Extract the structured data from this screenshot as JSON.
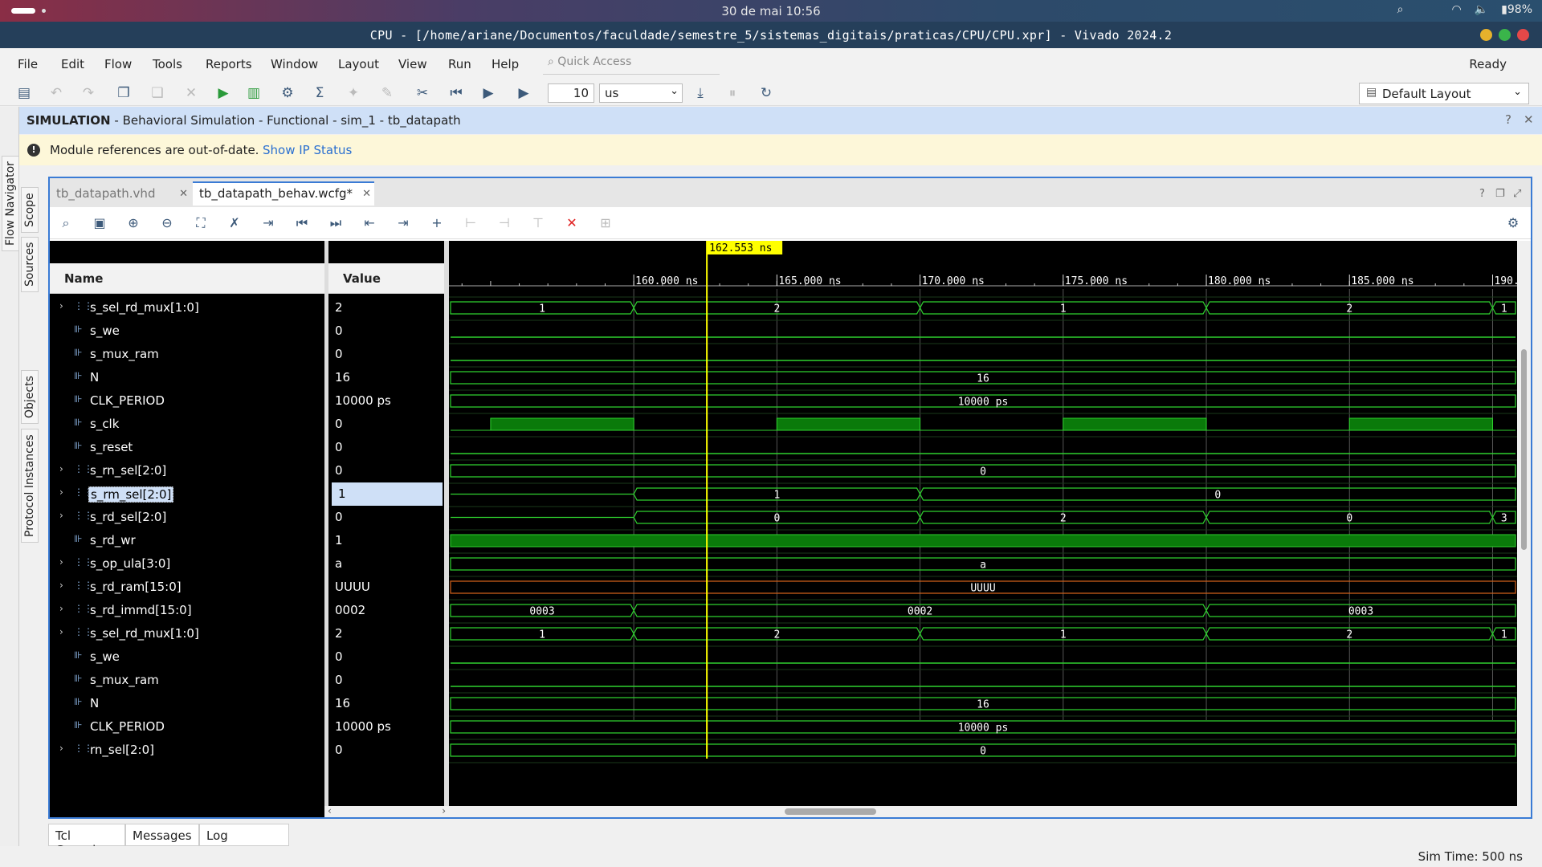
{
  "system": {
    "clock": "30 de mai 10:56",
    "battery": "98%"
  },
  "window": {
    "title": "CPU - [/home/ariane/Documentos/faculdade/semestre_5/sistemas_digitais/praticas/CPU/CPU.xpr] - Vivado 2024.2"
  },
  "menu": {
    "items": [
      "File",
      "Edit",
      "Flow",
      "Tools",
      "Reports",
      "Window",
      "Layout",
      "View",
      "Run",
      "Help"
    ],
    "quick_access_placeholder": "Quick Access",
    "status": "Ready"
  },
  "toolbar": {
    "run_time_value": "10",
    "run_time_unit": "us",
    "layout": "Default Layout"
  },
  "side_tabs": [
    "Flow Navigator",
    "Scope",
    "Sources",
    "Objects",
    "Protocol Instances"
  ],
  "sim_header": {
    "label": "SIMULATION",
    "detail": " - Behavioral Simulation - Functional - sim_1 - tb_datapath"
  },
  "notice": {
    "text": "Module references are out-of-date.",
    "link": "Show IP Status"
  },
  "editor_tabs": [
    "tb_datapath.vhd",
    "tb_datapath_behav.wcfg*"
  ],
  "columns": {
    "name": "Name",
    "value": "Value"
  },
  "signals": [
    {
      "name": "s_sel_rd_mux[1:0]",
      "value": "2",
      "bus": true
    },
    {
      "name": "s_we",
      "value": "0",
      "bus": false
    },
    {
      "name": "s_mux_ram",
      "value": "0",
      "bus": false
    },
    {
      "name": "N",
      "value": "16",
      "bus": false
    },
    {
      "name": "CLK_PERIOD",
      "value": "10000 ps",
      "bus": false
    },
    {
      "name": "s_clk",
      "value": "0",
      "bus": false
    },
    {
      "name": "s_reset",
      "value": "0",
      "bus": false
    },
    {
      "name": "s_rn_sel[2:0]",
      "value": "0",
      "bus": true
    },
    {
      "name": "s_rm_sel[2:0]",
      "value": "1",
      "bus": true,
      "selected": true
    },
    {
      "name": "s_rd_sel[2:0]",
      "value": "0",
      "bus": true
    },
    {
      "name": "s_rd_wr",
      "value": "1",
      "bus": false
    },
    {
      "name": "s_op_ula[3:0]",
      "value": "a",
      "bus": true
    },
    {
      "name": "s_rd_ram[15:0]",
      "value": "UUUU",
      "bus": true
    },
    {
      "name": "s_rd_immd[15:0]",
      "value": "0002",
      "bus": true
    },
    {
      "name": "s_sel_rd_mux[1:0]",
      "value": "2",
      "bus": true
    },
    {
      "name": "s_we",
      "value": "0",
      "bus": false
    },
    {
      "name": "s_mux_ram",
      "value": "0",
      "bus": false
    },
    {
      "name": "N",
      "value": "16",
      "bus": false
    },
    {
      "name": "CLK_PERIOD",
      "value": "10000 ps",
      "bus": false
    },
    {
      "name": "rn_sel[2:0]",
      "value": "0",
      "bus": true
    }
  ],
  "wave": {
    "cursor": "162.553 ns",
    "cursor_time_ns": 162.553,
    "time_start_ns": 153.6,
    "time_end_ns": 190.8,
    "tick_labels": [
      "160.000 ns",
      "165.000 ns",
      "170.000 ns",
      "175.000 ns",
      "180.000 ns",
      "185.000 ns",
      "190.000 ns"
    ],
    "ticks_ns": [
      160,
      165,
      170,
      175,
      180,
      185,
      190
    ],
    "clock": {
      "period_ns": 10,
      "high_start_ns": 165,
      "high_ns": 5
    },
    "buses": {
      "0": [
        {
          "t": 153.6,
          "v": "1"
        },
        {
          "t": 160,
          "v": "2"
        },
        {
          "t": 170,
          "v": "1"
        },
        {
          "t": 180,
          "v": "2"
        },
        {
          "t": 190,
          "v": "1"
        }
      ],
      "3": [
        {
          "t": 153.6,
          "v": "16"
        }
      ],
      "4": [
        {
          "t": 153.6,
          "v": "10000 ps"
        }
      ],
      "7": [
        {
          "t": 153.6,
          "v": "0"
        }
      ],
      "8": [
        {
          "t": 160,
          "v": "1"
        },
        {
          "t": 170,
          "v": "0"
        }
      ],
      "9": [
        {
          "t": 160,
          "v": "0"
        },
        {
          "t": 170,
          "v": "2"
        },
        {
          "t": 180,
          "v": "0"
        },
        {
          "t": 190,
          "v": "3"
        }
      ],
      "11": [
        {
          "t": 153.6,
          "v": "a"
        }
      ],
      "12": [
        {
          "t": 153.6,
          "v": "UUUU"
        }
      ],
      "13": [
        {
          "t": 153.6,
          "v": "0003"
        },
        {
          "t": 160,
          "v": "0002"
        },
        {
          "t": 180,
          "v": "0003"
        }
      ],
      "14": [
        {
          "t": 153.6,
          "v": "1"
        },
        {
          "t": 160,
          "v": "2"
        },
        {
          "t": 170,
          "v": "1"
        },
        {
          "t": 180,
          "v": "2"
        },
        {
          "t": 190,
          "v": "1"
        }
      ],
      "17": [
        {
          "t": 153.6,
          "v": "16"
        }
      ],
      "18": [
        {
          "t": 153.6,
          "v": "10000 ps"
        }
      ],
      "19": [
        {
          "t": 153.6,
          "v": "0"
        }
      ]
    },
    "low_rows": [
      1,
      2,
      6,
      15,
      16
    ],
    "high_rows": [
      10
    ],
    "undefined_rows": [
      12
    ],
    "clock_rows": [
      5
    ]
  },
  "bottom_tabs": [
    "Tcl Console",
    "Messages",
    "Log"
  ],
  "status_bar": "Sim Time: 500 ns",
  "colors": {
    "wave": "#2fd12f",
    "clock_fill": "#0a7a0a",
    "cursor": "#ffff00",
    "undef": "#d0601a",
    "selection": "#cfe0f7"
  }
}
